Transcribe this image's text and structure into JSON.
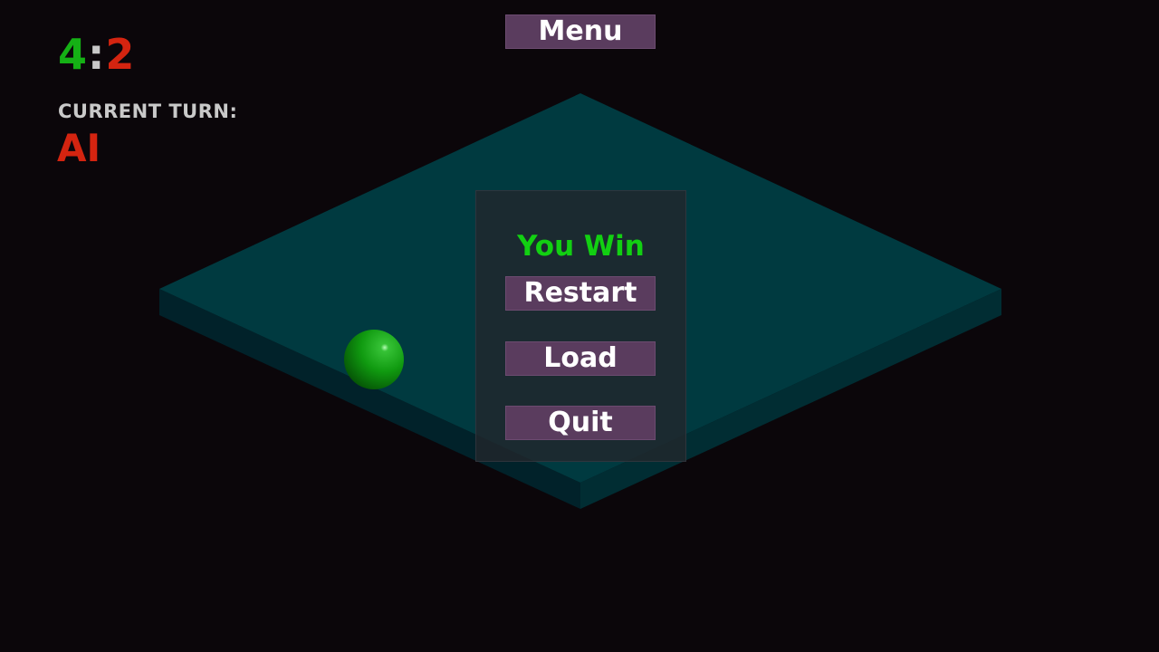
{
  "menu": {
    "label": "Menu"
  },
  "score": {
    "player": "4",
    "separator": ":",
    "ai": "2",
    "player_color": "#15b015",
    "ai_color": "#d42410"
  },
  "turn": {
    "label": "CURRENT TURN:",
    "value": "AI"
  },
  "result_dialog": {
    "title": "You Win",
    "restart_label": "Restart",
    "load_label": "Load",
    "quit_label": "Quit"
  },
  "board": {
    "top_color": "#003a40",
    "side_color": "#012a30",
    "piece": {
      "color": "green",
      "icon": "sphere"
    }
  }
}
